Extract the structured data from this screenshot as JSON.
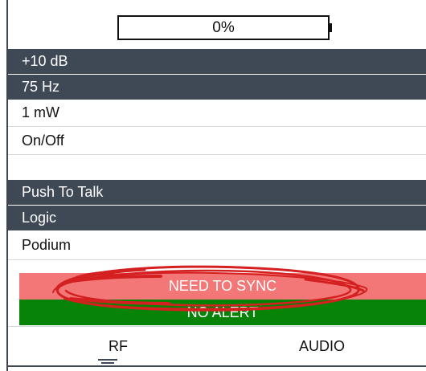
{
  "battery": {
    "label": "0%",
    "level": 0
  },
  "rows": [
    {
      "label": "+10 dB",
      "style": "dark"
    },
    {
      "label": "75 Hz",
      "style": "dark"
    },
    {
      "label": "1 mW",
      "style": "light"
    },
    {
      "label": "On/Off",
      "style": "light"
    },
    {
      "label": "Push To Talk",
      "style": "dark"
    },
    {
      "label": "Logic",
      "style": "dark"
    },
    {
      "label": "Podium",
      "style": "light"
    }
  ],
  "alerts": {
    "sync": {
      "label": "NEED TO SYNC",
      "color": "#f47777"
    },
    "status": {
      "label": "NO ALERT",
      "color": "#078307"
    }
  },
  "tabs": {
    "rf": "RF",
    "audio": "AUDIO",
    "active": "RF"
  },
  "colors": {
    "dark_row": "#3f4956",
    "annotation": "#d42020"
  }
}
